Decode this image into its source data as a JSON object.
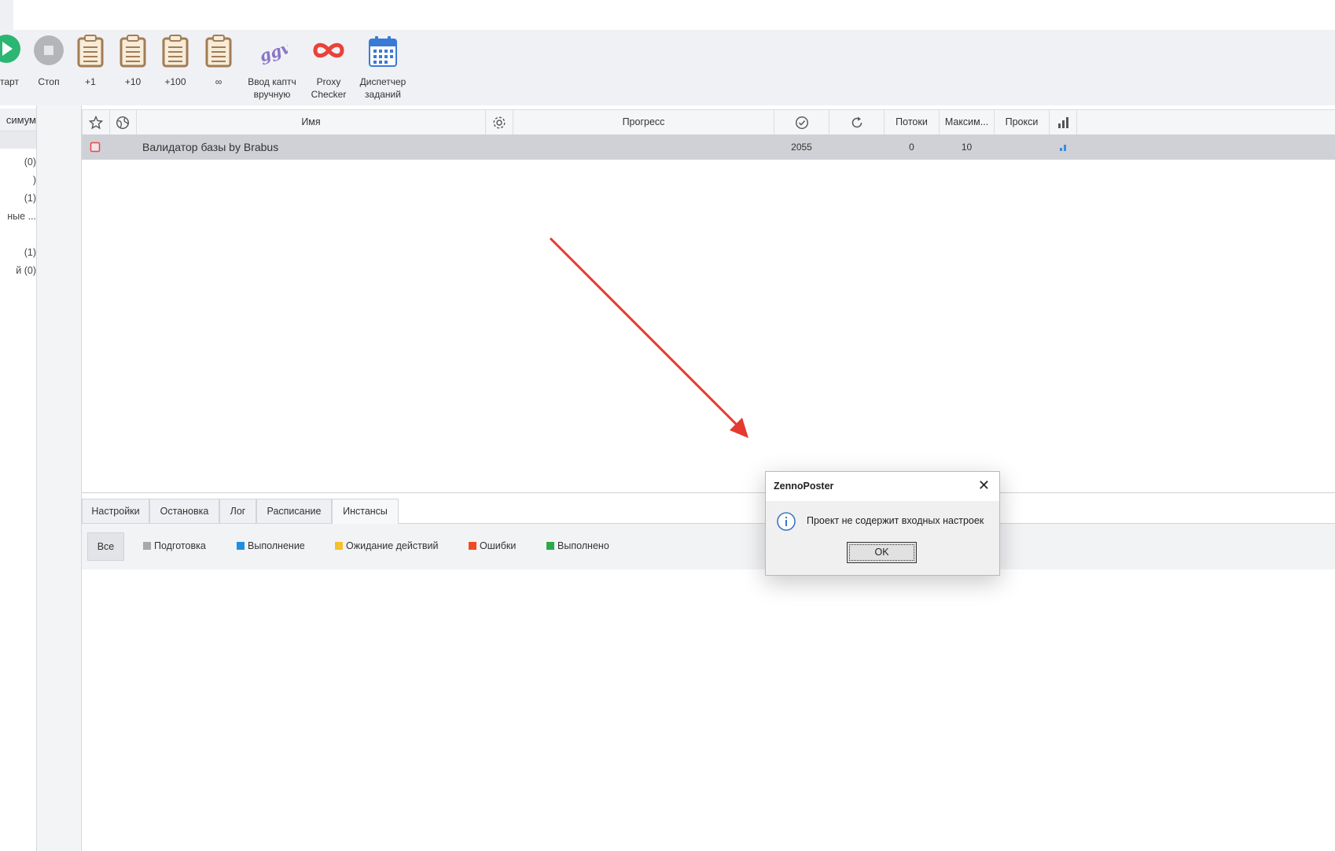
{
  "toolbar": {
    "start_label": "тарт",
    "stop_label": "Стоп",
    "plus1_label": "+1",
    "plus10_label": "+10",
    "plus100_label": "+100",
    "infinite_label": "∞",
    "captcha_label_line1": "Ввод каптч",
    "captcha_label_line2": "вручную",
    "proxy_label_line1": "Proxy",
    "proxy_label_line2": "Checker",
    "scheduler_label_line1": "Диспетчер",
    "scheduler_label_line2": "заданий"
  },
  "left_panel": {
    "header": "симум",
    "items": [
      "(0)",
      ")",
      "(1)",
      "ные ...",
      "(1)",
      "й (0)"
    ]
  },
  "grid": {
    "columns": {
      "name": "Имя",
      "progress": "Прогресс",
      "threads": "Потоки",
      "max": "Максим...",
      "proxy": "Прокси"
    },
    "rows": [
      {
        "name": "Валидатор базы by Brabus",
        "success": "2055",
        "threads": "0",
        "max": "10"
      }
    ]
  },
  "tabs": [
    "Настройки",
    "Остановка",
    "Лог",
    "Расписание",
    "Инстансы"
  ],
  "active_tab": "Инстансы",
  "filters": {
    "all": "Все",
    "legend": [
      {
        "label": "Подготовка",
        "color": "#a9a9a9"
      },
      {
        "label": "Выполнение",
        "color": "#1e8fe1"
      },
      {
        "label": "Ожидание действий",
        "color": "#f5c02b"
      },
      {
        "label": "Ошибки",
        "color": "#f04a24"
      },
      {
        "label": "Выполнено",
        "color": "#2ea84a"
      }
    ]
  },
  "dialog": {
    "title": "ZennoPoster",
    "message": "Проект не содержит входных настроек",
    "ok": "OK"
  },
  "colors": {
    "accent_start": "#2bb673",
    "arrow": "#e53a2f",
    "proxy_icon": "#e8423a",
    "scheduler_icon": "#3a7ad7"
  }
}
